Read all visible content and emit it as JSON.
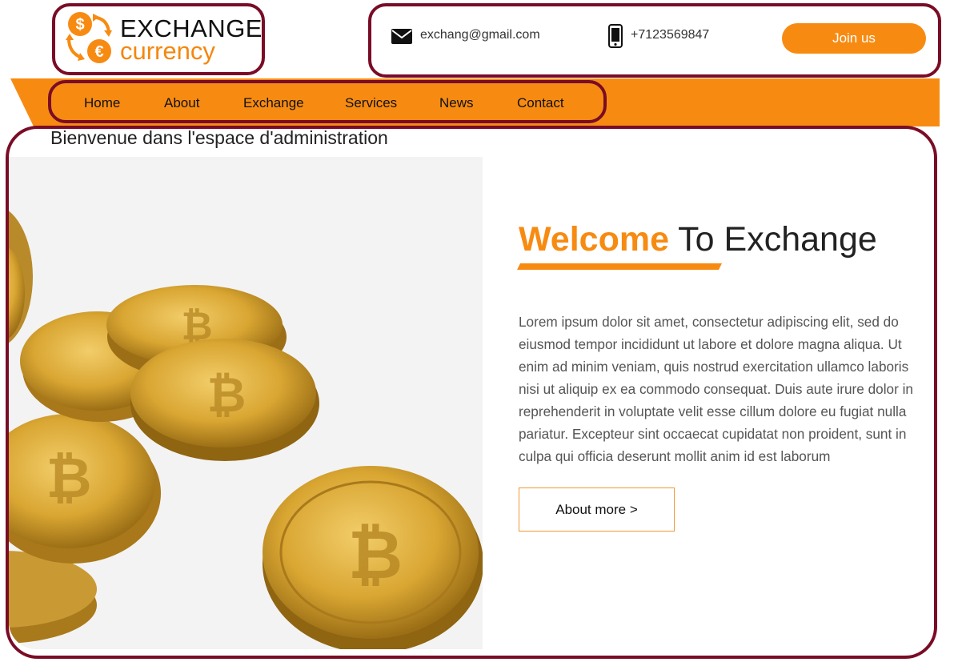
{
  "brand": {
    "word1": "EXCHANGE",
    "word2": "currency",
    "dollar_symbol": "$",
    "euro_symbol": "€",
    "accent_color": "#f78b12",
    "frame_color": "#7a0c26"
  },
  "contact": {
    "email_icon": "envelope-icon",
    "email": "exchang@gmail.com",
    "phone_icon": "mobile-phone-icon",
    "phone": "+7123569847",
    "join_label": "Join us"
  },
  "nav": {
    "items": [
      {
        "label": "Home"
      },
      {
        "label": "About"
      },
      {
        "label": "Exchange"
      },
      {
        "label": "Services"
      },
      {
        "label": "News"
      },
      {
        "label": "Contact"
      }
    ]
  },
  "main": {
    "admin_title": "Bienvenue dans l'espace d'administration",
    "hero_image": "bitcoin-coins-image",
    "welcome_accent": "Welcome",
    "welcome_rest": " To Exchange",
    "body": "Lorem ipsum dolor sit amet, consectetur adipiscing elit, sed do eiusmod tempor incididunt ut labore et dolore magna aliqua. Ut enim ad minim veniam, quis nostrud exercitation ullamco laboris nisi ut aliquip ex ea commodo consequat. Duis aute irure dolor in reprehenderit in voluptate velit esse cillum dolore eu fugiat nulla pariatur. Excepteur sint occaecat cupidatat non proident, sunt in culpa qui officia deserunt mollit anim id est laborum",
    "about_label": "About more >"
  }
}
